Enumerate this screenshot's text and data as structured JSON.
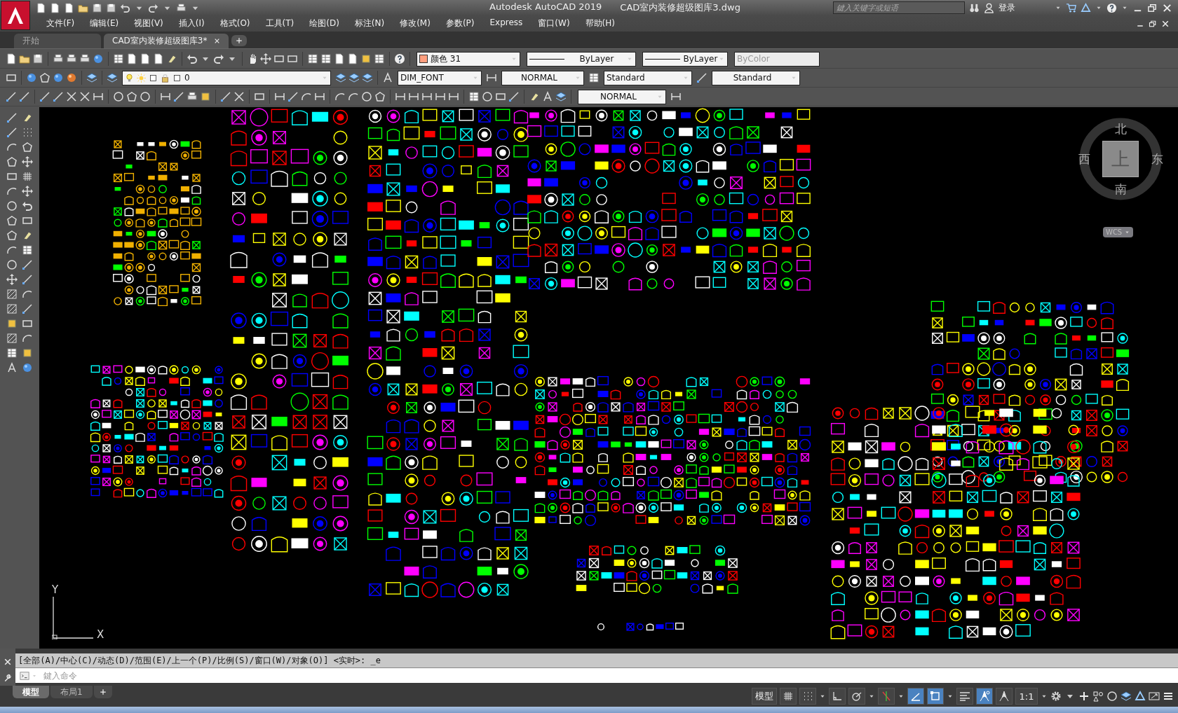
{
  "title_bar": {
    "app_name": "Autodesk AutoCAD 2019",
    "file_name": "CAD室内装修超级图库3.dwg",
    "search": {
      "placeholder": "鍵入关键字或短语"
    },
    "sign_in": "登录"
  },
  "menu_bar": [
    "文件(F)",
    "编辑(E)",
    "视图(V)",
    "插入(I)",
    "格式(O)",
    "工具(T)",
    "绘图(D)",
    "标注(N)",
    "修改(M)",
    "参数(P)",
    "Express",
    "窗口(W)",
    "帮助(H)"
  ],
  "doc_tabs": [
    {
      "label": "开始",
      "selected": false
    },
    {
      "label": "CAD室内装修超级图库3*",
      "selected": true
    }
  ],
  "toolbars": {
    "color": {
      "label": "颜色 31",
      "color": "#ff9f7f"
    },
    "linetype": "ByLayer",
    "lineweight": "ByLayer",
    "plot_style": {
      "label": "ByColor",
      "disabled": true
    },
    "layer": "0",
    "text_style": "DIM_FONT",
    "dim_style": "NORMAL",
    "table_style": "Standard",
    "multileader_style": "Standard",
    "current_dim_style": "NORMAL"
  },
  "viewcube": {
    "north": "北",
    "south": "南",
    "east": "东",
    "west": "西",
    "face": "上",
    "coordinate_system": "WCS"
  },
  "ucs_icon": {
    "y_label": "Y",
    "x_label": "X"
  },
  "command_line": {
    "history": "[全部(A)/中心(C)/动态(D)/范围(E)/上一个(P)/比例(S)/窗口(W)/对象(O)] <实时>: _e",
    "placeholder": "鍵入命令"
  },
  "layout_tabs": [
    {
      "label": "模型",
      "selected": true
    },
    {
      "label": "布局1",
      "selected": false
    }
  ],
  "status_bar": {
    "space": "模型",
    "toggles": [
      {
        "kind": "grid",
        "on": false
      },
      {
        "kind": "snap",
        "on": false
      },
      {
        "kind": "ortho",
        "on": false
      },
      {
        "kind": "polar",
        "on": false
      },
      {
        "kind": "track",
        "on": false
      },
      {
        "kind": "isodraft",
        "on": true
      },
      {
        "kind": "osnap",
        "on": true
      },
      {
        "kind": "lineweight",
        "on": false
      },
      {
        "kind": "annovis",
        "on": true
      },
      {
        "kind": "autoscale",
        "on": false
      }
    ],
    "annotation_scale": "1:1"
  }
}
